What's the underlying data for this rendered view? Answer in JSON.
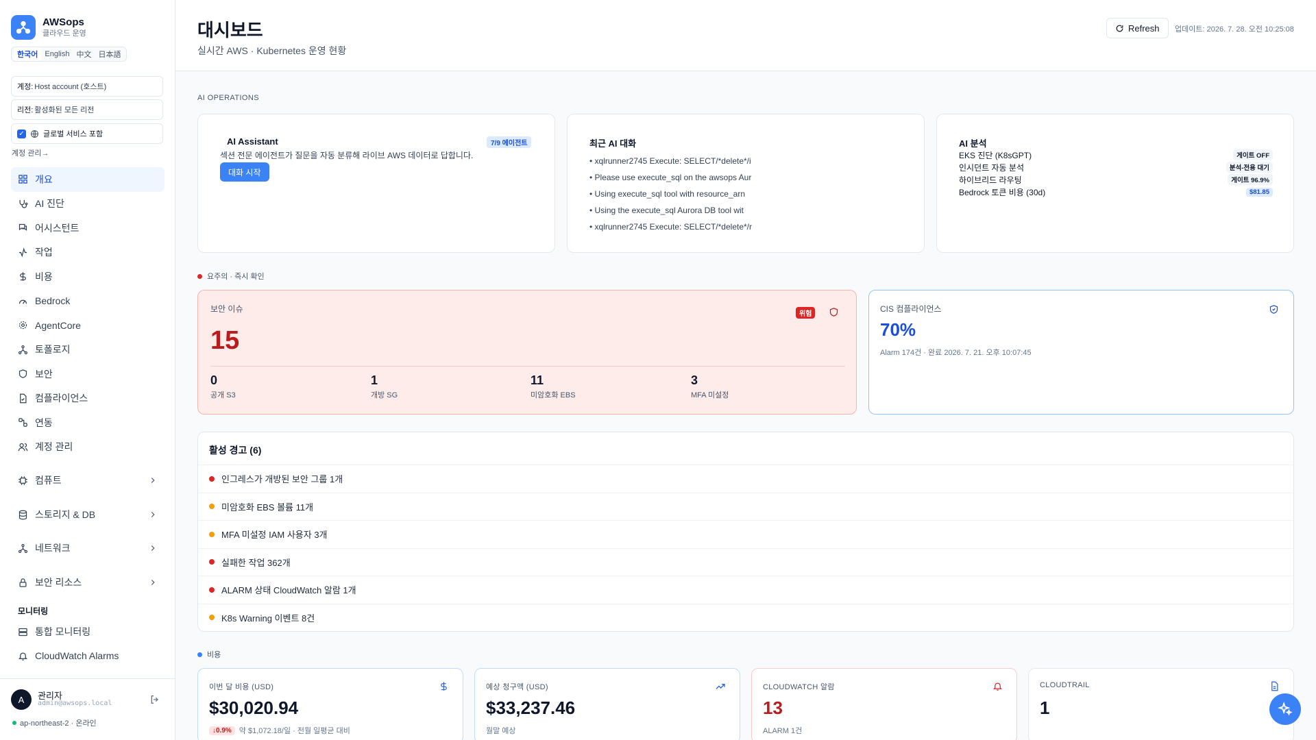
{
  "app": {
    "name": "AWSops",
    "subtitle": "클라우드 운영"
  },
  "languages": [
    {
      "label": "한국어",
      "active": true
    },
    {
      "label": "English"
    },
    {
      "label": "中文"
    },
    {
      "label": "日本語"
    }
  ],
  "filters": {
    "account_key": "계정:",
    "account_value": "Host account (호스트)",
    "region_key": "리전:",
    "region_value": "활성화된 모든 리전",
    "global_label": "글로벌 서비스 포함",
    "manage_link": "계정 관리→"
  },
  "nav": [
    {
      "label": "개요",
      "icon": "grid-icon",
      "active": true
    },
    {
      "label": "AI 진단",
      "icon": "stethoscope-icon"
    },
    {
      "label": "어시스턴트",
      "icon": "chat-icon"
    },
    {
      "label": "작업",
      "icon": "activity-icon"
    },
    {
      "label": "비용",
      "icon": "dollar-icon"
    },
    {
      "label": "Bedrock",
      "icon": "gauge-icon"
    },
    {
      "label": "AgentCore",
      "icon": "cog-icon"
    },
    {
      "label": "토폴로지",
      "icon": "topology-icon"
    },
    {
      "label": "보안",
      "icon": "shield-icon"
    },
    {
      "label": "컴플라이언스",
      "icon": "file-check-icon"
    },
    {
      "label": "연동",
      "icon": "link-icon"
    },
    {
      "label": "계정 관리",
      "icon": "users-icon"
    }
  ],
  "groups": [
    {
      "label": "컴퓨트",
      "icon": "cpu-icon"
    },
    {
      "label": "스토리지 & DB",
      "icon": "database-icon"
    },
    {
      "label": "네트워크",
      "icon": "network-icon"
    },
    {
      "label": "보안 리소스",
      "icon": "lock-icon"
    }
  ],
  "monitoring": {
    "title": "모니터링",
    "items": [
      {
        "label": "통합 모니터링",
        "icon": "server-icon"
      },
      {
        "label": "CloudWatch Alarms",
        "icon": "bell-icon"
      }
    ]
  },
  "user": {
    "initial": "A",
    "name": "관리자",
    "email": "admin@awsops.local",
    "status": "ap-northeast-2 · 온라인"
  },
  "header": {
    "title": "대시보드",
    "subtitle": "실시간 AWS · Kubernetes 운영 현황",
    "refresh": "Refresh",
    "updated": "업데이트: 2026. 7. 28. 오전 10:25:08"
  },
  "ai_ops": {
    "section": "AI OPERATIONS",
    "assistant": {
      "title": "AI Assistant",
      "badge": "7/9 에이전트",
      "desc": "섹션 전문 에이전트가 질문을 자동 분류해 라이브 AWS 데이터로 답합니다.",
      "button": "대화 시작"
    },
    "recent": {
      "title": "최근 AI 대화",
      "items": [
        "• xqlrunner2745 Execute: SELECT/*delete*/i",
        "• Please use execute_sql on the awsops Aur",
        "• Using execute_sql tool with resource_arn",
        "• Using the execute_sql Aurora DB tool wit",
        "• xqlrunner2745 Execute: SELECT/*delete*/r"
      ]
    },
    "analysis": {
      "title": "AI 분석",
      "rows": [
        {
          "label": "EKS 진단 (K8sGPT)",
          "badge": "게이트 OFF"
        },
        {
          "label": "인시던트 자동 분석",
          "badge": "분석-전용 대기"
        },
        {
          "label": "하이브리드 라우팅",
          "badge": "게이트 96.9%"
        },
        {
          "label": "Bedrock 토큰 비용 (30d)",
          "badge": "$81.85",
          "blue": true
        }
      ]
    }
  },
  "attention": {
    "label": "요주의 · 즉시 확인"
  },
  "security": {
    "label": "보안 이슈",
    "badge": "위험",
    "value": "15",
    "stats": [
      {
        "value": "0",
        "label": "공개 S3"
      },
      {
        "value": "1",
        "label": "개방 SG"
      },
      {
        "value": "11",
        "label": "미암호화 EBS"
      },
      {
        "value": "3",
        "label": "MFA 미설정"
      }
    ]
  },
  "cis": {
    "label": "CIS 컴플라이언스",
    "value": "70%",
    "sub": "Alarm 174건 · 완료 2026. 7. 21. 오후 10:07:45"
  },
  "alerts": {
    "title": "활성 경고 (6)",
    "items": [
      {
        "text": "인그레스가 개방된 보안 그룹 1개",
        "color": "#dc2626"
      },
      {
        "text": "미암호화 EBS 볼륨 11개",
        "color": "#f59e0b"
      },
      {
        "text": "MFA 미설정 IAM 사용자 3개",
        "color": "#f59e0b"
      },
      {
        "text": "실패한 작업 362개",
        "color": "#dc2626"
      },
      {
        "text": "ALARM 상태 CloudWatch 알람 1개",
        "color": "#dc2626"
      },
      {
        "text": "K8s Warning 이벤트 8건",
        "color": "#f59e0b"
      }
    ]
  },
  "cost": {
    "section": "비용",
    "kpis": [
      {
        "label": "이번 달 비용 (USD)",
        "value": "$30,020.94",
        "badge": "↓0.9%",
        "note": "약 $1,072.18/일 · 전월 일평균 대비",
        "icon": "dollar-icon",
        "border": "#bfdbfe"
      },
      {
        "label": "예상 청구액 (USD)",
        "value": "$33,237.46",
        "note": "월말 예상",
        "icon": "trending-up-icon",
        "border": "#bfdbfe"
      },
      {
        "label": "CLOUDWATCH 알람",
        "value": "13",
        "note": "ALARM 1건",
        "icon": "bell-icon",
        "border": "#fecaca",
        "red": true
      },
      {
        "label": "CLOUDTRAIL",
        "value": "1",
        "note": "",
        "icon": "file-icon",
        "border": "#e2e8f0"
      }
    ]
  },
  "colors": {
    "accent": "#3b82f6",
    "danger": "#dc2626",
    "warning": "#f59e0b",
    "success": "#10b981"
  }
}
